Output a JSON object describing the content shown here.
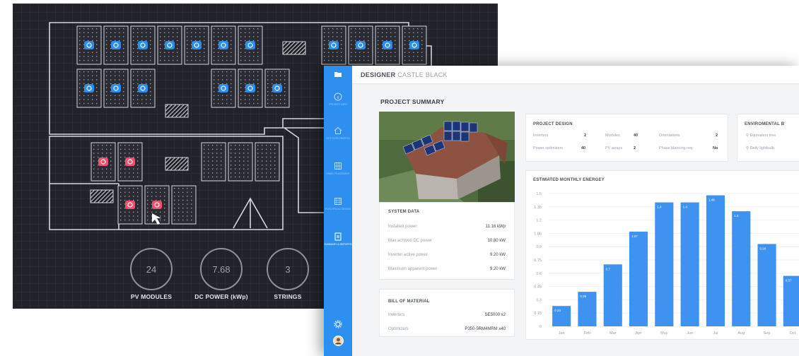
{
  "dark_view": {
    "stats": [
      {
        "value": "24",
        "label": "PV MODULES"
      },
      {
        "value": "7.68",
        "label": "DC POWER (kWp)"
      },
      {
        "value": "3",
        "label": "STRINGS"
      }
    ]
  },
  "designer": {
    "title_bold": "DESIGNER",
    "title_rest": " CASTLE BLACK",
    "heading": "PROJECT SUMMARY",
    "sidebar": [
      {
        "label": "PROJECT INFO",
        "icon": "info-icon"
      },
      {
        "label": "SITE EXPLORATION",
        "icon": "house-icon"
      },
      {
        "label": "PANEL PLACEMENT",
        "icon": "panel-grid-icon"
      },
      {
        "label": "ELECTRICAL DESIGN",
        "icon": "circuit-icon"
      },
      {
        "label": "SUMMARY & REPORTS",
        "icon": "report-icon"
      }
    ],
    "system_data": {
      "title": "SYSTEM DATA",
      "rows": [
        {
          "label": "Installed power",
          "value": "11.16 kWp"
        },
        {
          "label": "Max achived DC power",
          "value": "10.80 kW"
        },
        {
          "label": "Inverter active power",
          "value": "9.20 kW"
        },
        {
          "label": "Maximum apparent power",
          "value": "9.20 kW"
        }
      ]
    },
    "bill_of_material": {
      "title": "BILL OF MATERIAL",
      "rows": [
        {
          "label": "Inverters",
          "value": "SE5000 x2"
        },
        {
          "label": "Optimizers",
          "value": "P350-5RM4MRM x40"
        }
      ]
    },
    "project_design": {
      "title": "PROJECT DESIGN",
      "items": [
        {
          "label": "Inverters",
          "value": "2"
        },
        {
          "label": "Modules",
          "value": "40"
        },
        {
          "label": "Orientations",
          "value": "2"
        },
        {
          "label": "Power optimizers",
          "value": "40"
        },
        {
          "label": "PV arrays",
          "value": "2"
        },
        {
          "label": "Phase blancing req",
          "value": "No"
        }
      ]
    },
    "environmental": {
      "title": "ENVIROMENTAL B",
      "items": [
        "Equivalent tree",
        "Daily lightbulb"
      ]
    }
  },
  "chart_data": {
    "type": "bar",
    "title": "ESTIMATED MONTHLY ENERGEY",
    "categories": [
      "Jan",
      "Feb",
      "Mar",
      "Apr",
      "May",
      "Jun",
      "Jul",
      "Aug",
      "Sep",
      "Oct"
    ],
    "values": [
      0.23,
      0.39,
      0.7,
      1.07,
      1.4,
      1.4,
      1.48,
      1.3,
      0.93,
      0.57
    ],
    "data_labels": [
      "0.23",
      "0.39",
      "0.7",
      "1.07",
      "1.4",
      "1.4",
      "1.48",
      "1.3",
      "0.93",
      "0.57"
    ],
    "yticks": [
      "0",
      "0.15",
      "0.3",
      "0.45",
      "0.6",
      "0.75",
      "0.9",
      "1.05",
      "1.2",
      "1.35",
      "1.5"
    ],
    "ylim": [
      0,
      1.5
    ],
    "grid": true,
    "bar_color": "#3f93f0"
  },
  "colors": {
    "accent": "#2d8ff0",
    "dark_bg": "#22232a",
    "module_blue": "#2b8df0",
    "module_red": "#f0506e"
  }
}
